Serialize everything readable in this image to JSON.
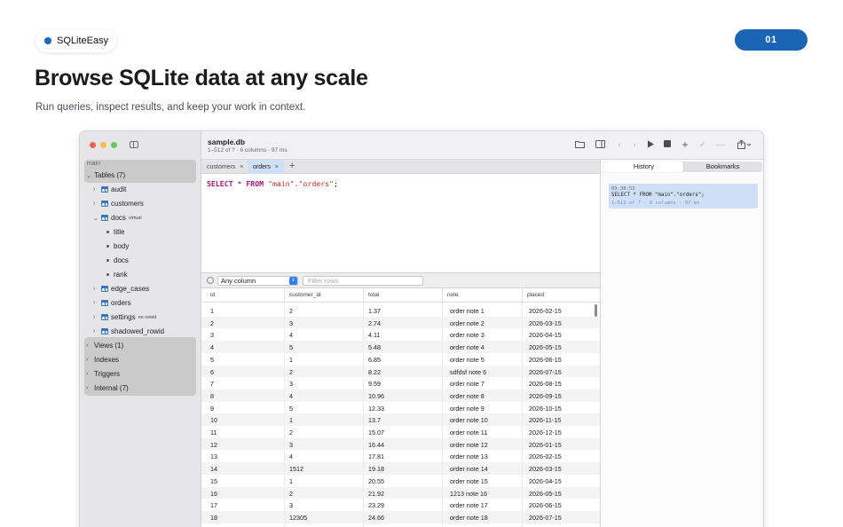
{
  "brand": {
    "name": "SQLiteEasy"
  },
  "page_number": "01",
  "hero": {
    "title": "Browse SQLite data at any scale",
    "subtitle": "Run queries, inspect results, and keep your work in context."
  },
  "window": {
    "db_name": "sample.db",
    "db_meta": "1–512 of ? · 6 columns · 97 ms"
  },
  "sidebar": {
    "section": "main",
    "tables_label": "Tables (7)",
    "items": {
      "audit": "audit",
      "customers": "customers",
      "docs": "docs",
      "docs_tag": "virtual",
      "col_title": "title",
      "col_body": "body",
      "col_docs": "docs",
      "col_rank": "rank",
      "edge_cases": "edge_cases",
      "orders": "orders",
      "settings": "settings",
      "settings_tag": "no rowid",
      "shadowed_rowid": "shadowed_rowid"
    },
    "views": "Views (1)",
    "indexes": "Indexes",
    "triggers": "Triggers",
    "internal": "Internal (7)"
  },
  "tabs": [
    {
      "label": "customers"
    },
    {
      "label": "orders"
    }
  ],
  "tab_close": "×",
  "tab_add": "+",
  "editor": {
    "kw1": "SELECT",
    "star": " * ",
    "kw2": "FROM",
    "schema": "\"main\"",
    "dot": ".",
    "table": "\"orders\"",
    "end": ";"
  },
  "filter": {
    "column_select": "Any column",
    "placeholder": "Filter rows"
  },
  "grid": {
    "columns": [
      "id",
      "customer_id",
      "total",
      "note",
      "placed"
    ],
    "rows": [
      [
        "1",
        "2",
        "1.37",
        "order note 1",
        "2026-02-15"
      ],
      [
        "2",
        "3",
        "2.74",
        "order note 2",
        "2026-03-15"
      ],
      [
        "3",
        "4",
        "4.11",
        "order note 3",
        "2026-04-15"
      ],
      [
        "4",
        "5",
        "5.48",
        "order note 4",
        "2026-05-15"
      ],
      [
        "5",
        "1",
        "6.85",
        "order note 5",
        "2026-06-15"
      ],
      [
        "6",
        "2",
        "8.22",
        "sdfdsf note 6",
        "2026-07-15"
      ],
      [
        "7",
        "3",
        "9.59",
        "order note 7",
        "2026-08-15"
      ],
      [
        "8",
        "4",
        "10.96",
        "order note 8",
        "2026-09-15"
      ],
      [
        "9",
        "5",
        "12.33",
        "order note 9",
        "2026-10-15"
      ],
      [
        "10",
        "1",
        "13.7",
        "order note 10",
        "2026-11-15"
      ],
      [
        "11",
        "2",
        "15.07",
        "order note 11",
        "2026-12-15"
      ],
      [
        "12",
        "3",
        "16.44",
        "order note 12",
        "2026-01-15"
      ],
      [
        "13",
        "4",
        "17.81",
        "order note 13",
        "2026-02-15"
      ],
      [
        "14",
        "1512",
        "19.18",
        "order note 14",
        "2026-03-15"
      ],
      [
        "15",
        "1",
        "20.55",
        "order note 15",
        "2026-04-15"
      ],
      [
        "16",
        "2",
        "21.92",
        "1213 note 16",
        "2026-05-15"
      ],
      [
        "17",
        "3",
        "23.29",
        "order note 17",
        "2026-06-15"
      ],
      [
        "18",
        "12305",
        "24.66",
        "order note 18",
        "2026-07-15"
      ]
    ]
  },
  "history_panel": {
    "tab_history": "History",
    "tab_bookmarks": "Bookmarks",
    "entry": {
      "time": "09:38:53",
      "sql": "SELECT * FROM \"main\".\"orders\";",
      "meta": "1–512 of ? · 6 columns · 97 ms"
    }
  },
  "colors": {
    "accent": "#1b64b4",
    "selection": "#cfe0f6",
    "keyword": "#b3157b",
    "string": "#c22b1e"
  },
  "icons": [
    "folder-icon",
    "panel-icon",
    "back-icon",
    "forward-icon",
    "run-icon",
    "stop-icon",
    "add-icon",
    "commit-icon",
    "remove-icon",
    "share-icon"
  ]
}
